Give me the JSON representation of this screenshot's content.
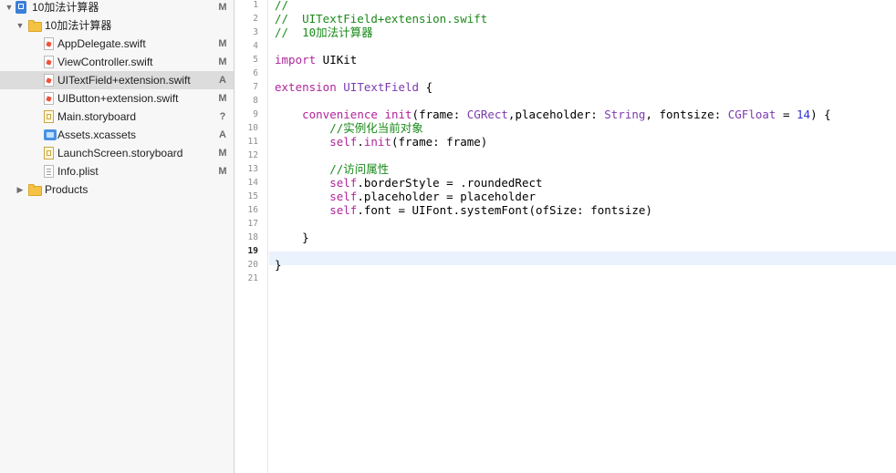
{
  "navigator": {
    "items": [
      {
        "label": "10加法计算器",
        "status": "M",
        "level": 0,
        "icon": "project-icon",
        "disclosure": "▼",
        "selected": false
      },
      {
        "label": "10加法计算器",
        "status": "",
        "level": 1,
        "icon": "folder-icon",
        "disclosure": "▼",
        "selected": false
      },
      {
        "label": "AppDelegate.swift",
        "status": "M",
        "level": 2,
        "icon": "swift-file-icon",
        "disclosure": "",
        "selected": false
      },
      {
        "label": "ViewController.swift",
        "status": "M",
        "level": 2,
        "icon": "swift-file-icon",
        "disclosure": "",
        "selected": false
      },
      {
        "label": "UITextField+extension.swift",
        "status": "A",
        "level": 2,
        "icon": "swift-file-icon",
        "disclosure": "",
        "selected": true
      },
      {
        "label": "UIButton+extension.swift",
        "status": "M",
        "level": 2,
        "icon": "swift-file-icon",
        "disclosure": "",
        "selected": false
      },
      {
        "label": "Main.storyboard",
        "status": "?",
        "level": 2,
        "icon": "storyboard-icon",
        "disclosure": "",
        "selected": false
      },
      {
        "label": "Assets.xcassets",
        "status": "A",
        "level": 2,
        "icon": "assets-icon",
        "disclosure": "",
        "selected": false
      },
      {
        "label": "LaunchScreen.storyboard",
        "status": "M",
        "level": 2,
        "icon": "storyboard-icon",
        "disclosure": "",
        "selected": false
      },
      {
        "label": "Info.plist",
        "status": "M",
        "level": 2,
        "icon": "plist-icon",
        "disclosure": "",
        "selected": false
      },
      {
        "label": "Products",
        "status": "",
        "level": 1,
        "icon": "folder-icon",
        "disclosure": "▶",
        "selected": false
      }
    ]
  },
  "editor": {
    "current_line": 19,
    "lines": [
      {
        "n": "1",
        "tokens": [
          {
            "t": "//",
            "c": "comment"
          }
        ]
      },
      {
        "n": "2",
        "tokens": [
          {
            "t": "//  UITextField+extension.swift",
            "c": "comment"
          }
        ]
      },
      {
        "n": "3",
        "tokens": [
          {
            "t": "//  10加法计算器",
            "c": "comment"
          }
        ]
      },
      {
        "n": "4",
        "tokens": []
      },
      {
        "n": "5",
        "tokens": [
          {
            "t": "import",
            "c": "keyword"
          },
          {
            "t": " UIKit",
            "c": "plain"
          }
        ]
      },
      {
        "n": "6",
        "tokens": []
      },
      {
        "n": "7",
        "tokens": [
          {
            "t": "extension",
            "c": "keyword"
          },
          {
            "t": " ",
            "c": "plain"
          },
          {
            "t": "UITextField",
            "c": "type"
          },
          {
            "t": " {",
            "c": "plain"
          }
        ]
      },
      {
        "n": "8",
        "tokens": []
      },
      {
        "n": "9",
        "tokens": [
          {
            "t": "    ",
            "c": "plain"
          },
          {
            "t": "convenience",
            "c": "keyword"
          },
          {
            "t": " ",
            "c": "plain"
          },
          {
            "t": "init",
            "c": "keyword"
          },
          {
            "t": "(frame: ",
            "c": "plain"
          },
          {
            "t": "CGRect",
            "c": "type"
          },
          {
            "t": ",placeholder: ",
            "c": "plain"
          },
          {
            "t": "String",
            "c": "type"
          },
          {
            "t": ", fontsize: ",
            "c": "plain"
          },
          {
            "t": "CGFloat",
            "c": "type"
          },
          {
            "t": " = ",
            "c": "plain"
          },
          {
            "t": "14",
            "c": "number"
          },
          {
            "t": ") {",
            "c": "plain"
          }
        ]
      },
      {
        "n": "10",
        "tokens": [
          {
            "t": "        ",
            "c": "plain"
          },
          {
            "t": "//实例化当前对象",
            "c": "comment"
          }
        ]
      },
      {
        "n": "11",
        "tokens": [
          {
            "t": "        ",
            "c": "plain"
          },
          {
            "t": "self",
            "c": "keyword"
          },
          {
            "t": ".",
            "c": "plain"
          },
          {
            "t": "init",
            "c": "keyword"
          },
          {
            "t": "(frame: frame)",
            "c": "plain"
          }
        ]
      },
      {
        "n": "12",
        "tokens": []
      },
      {
        "n": "13",
        "tokens": [
          {
            "t": "        ",
            "c": "plain"
          },
          {
            "t": "//访问属性",
            "c": "comment"
          }
        ]
      },
      {
        "n": "14",
        "tokens": [
          {
            "t": "        ",
            "c": "plain"
          },
          {
            "t": "self",
            "c": "keyword"
          },
          {
            "t": ".borderStyle = .roundedRect",
            "c": "plain"
          }
        ]
      },
      {
        "n": "15",
        "tokens": [
          {
            "t": "        ",
            "c": "plain"
          },
          {
            "t": "self",
            "c": "keyword"
          },
          {
            "t": ".placeholder = placeholder",
            "c": "plain"
          }
        ]
      },
      {
        "n": "16",
        "tokens": [
          {
            "t": "        ",
            "c": "plain"
          },
          {
            "t": "self",
            "c": "keyword"
          },
          {
            "t": ".font = UIFont.systemFont(ofSize: fontsize)",
            "c": "plain"
          }
        ]
      },
      {
        "n": "17",
        "tokens": []
      },
      {
        "n": "18",
        "tokens": [
          {
            "t": "    }",
            "c": "plain"
          }
        ]
      },
      {
        "n": "19",
        "tokens": []
      },
      {
        "n": "20",
        "tokens": [
          {
            "t": "}",
            "c": "plain"
          }
        ]
      },
      {
        "n": "21",
        "tokens": []
      }
    ]
  },
  "colors": {
    "comment": "#1b8a1b",
    "keyword": "#b0259b",
    "type": "#7b3ab0",
    "number": "#2c2fd6",
    "current_line_highlight": "#e9f2fd",
    "selection": "#dcdcdc"
  }
}
